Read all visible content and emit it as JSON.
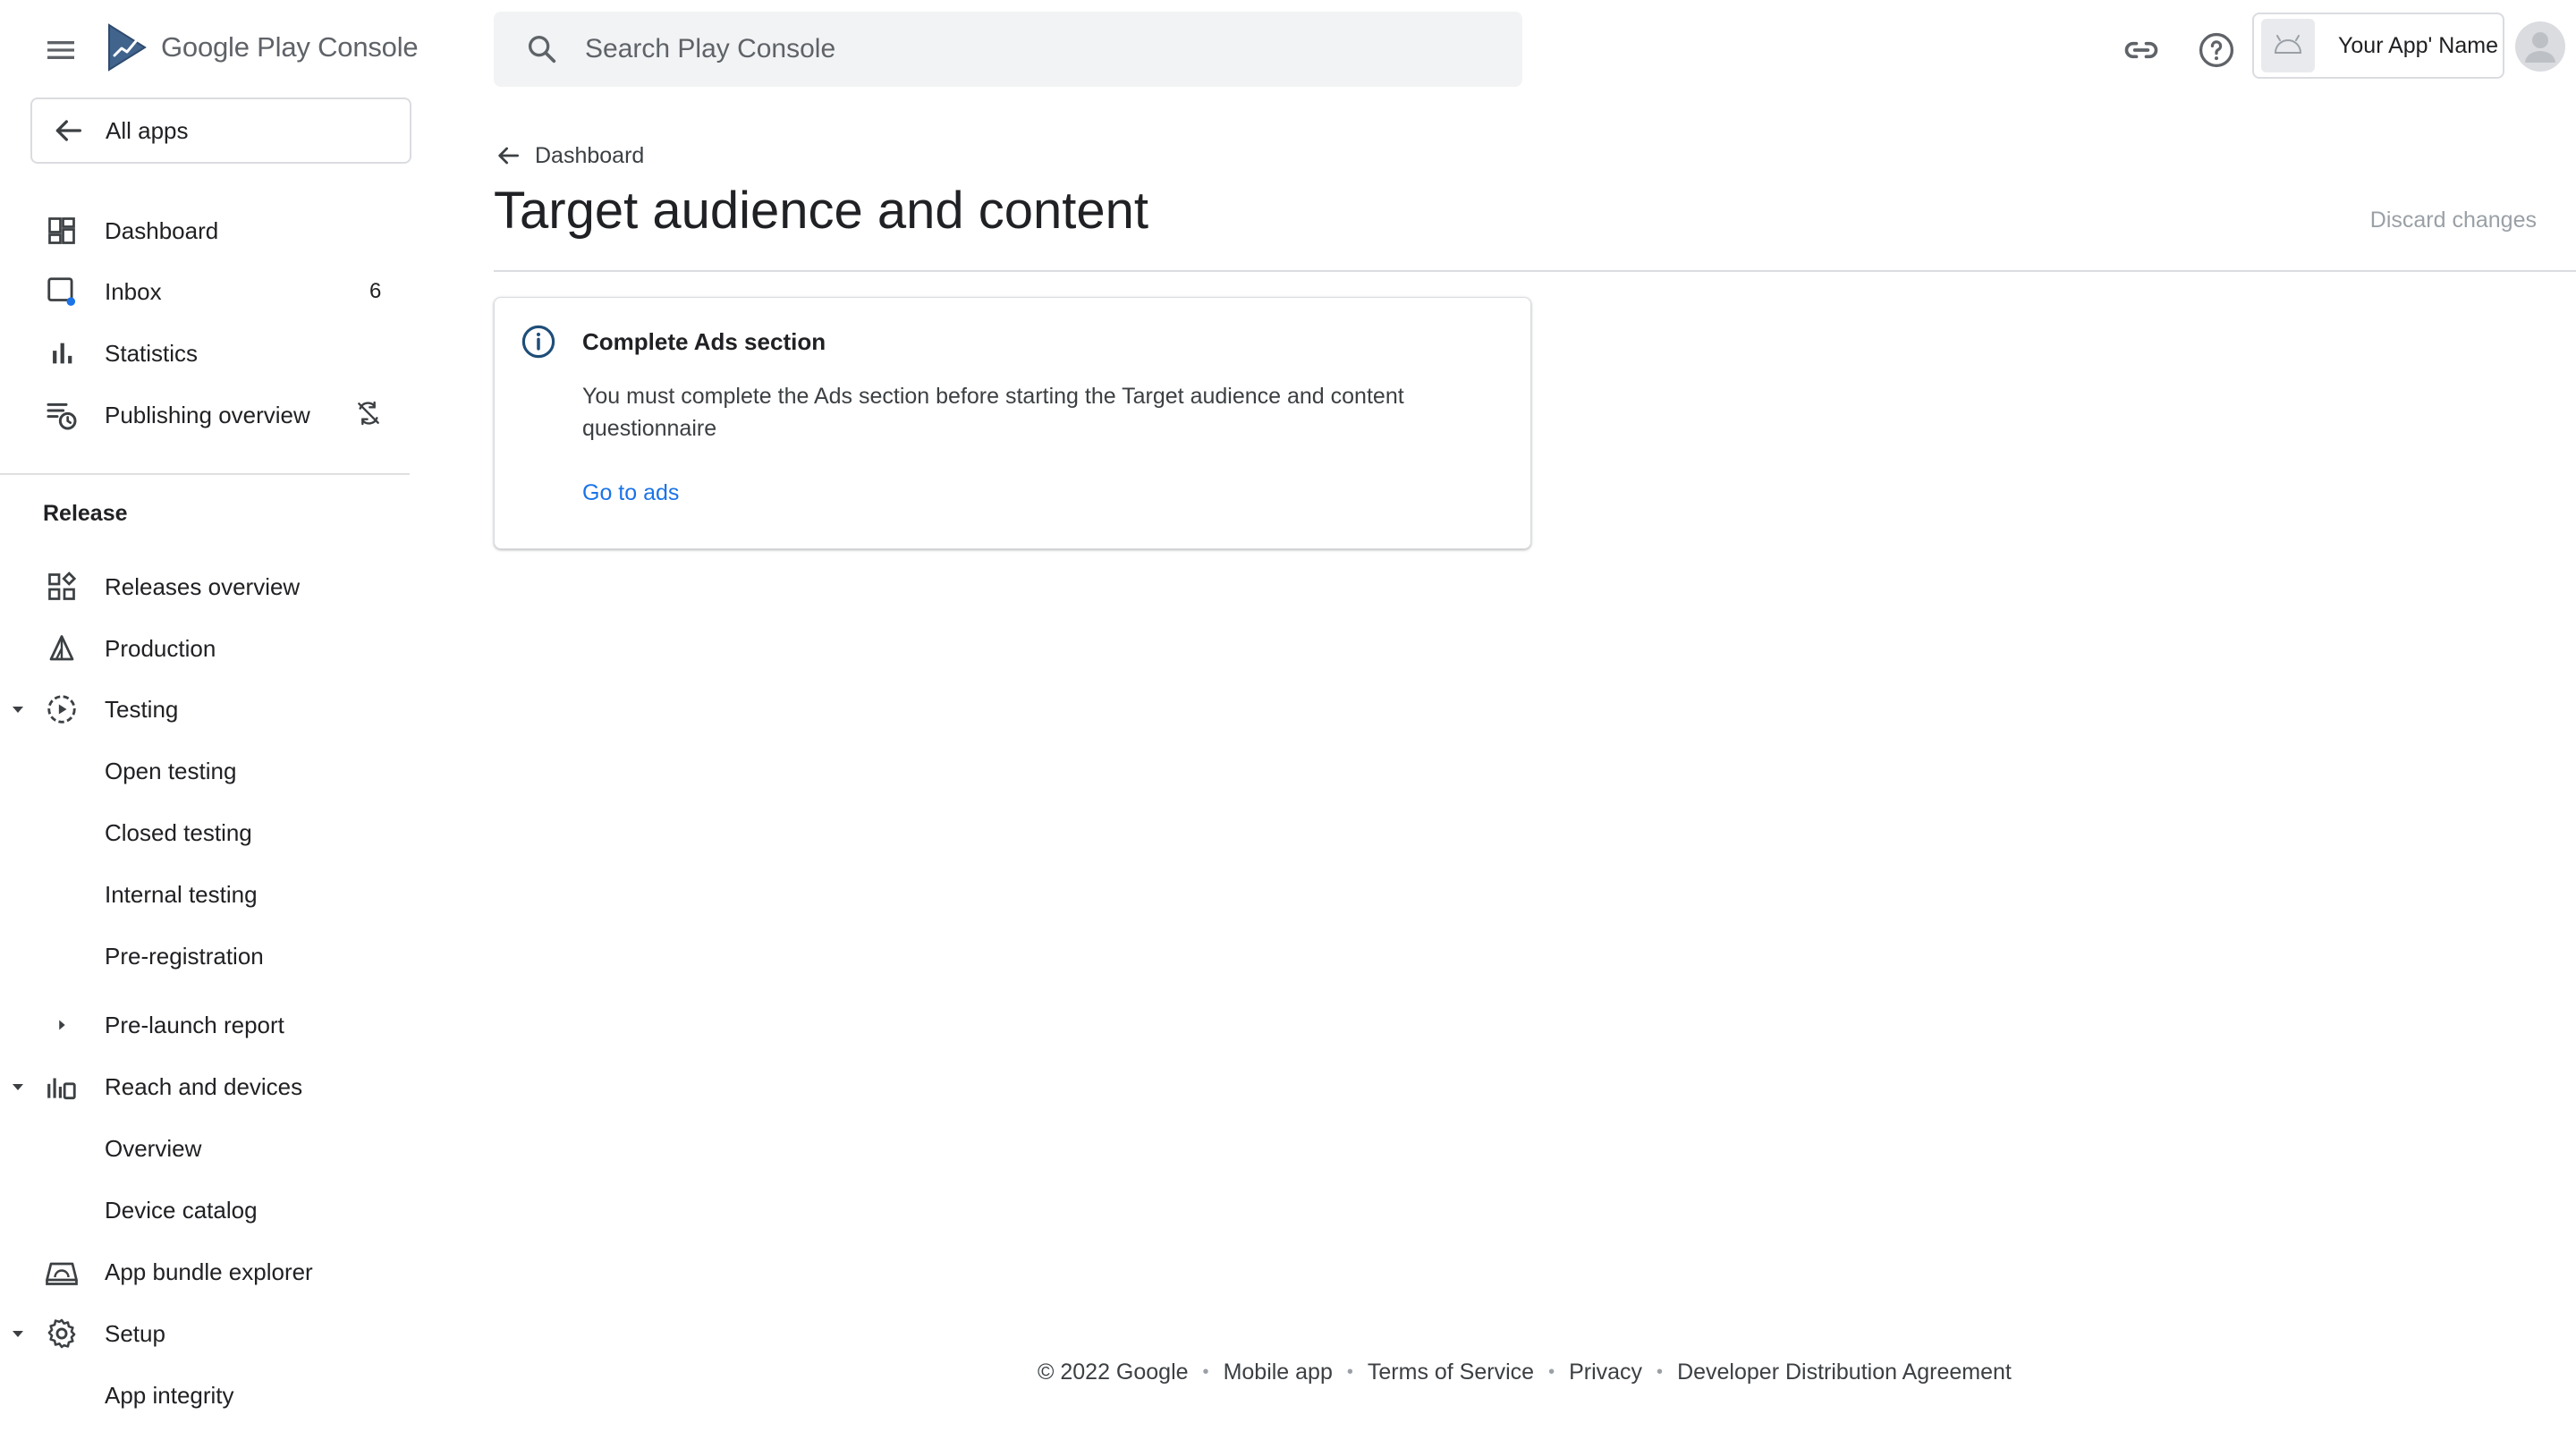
{
  "header": {
    "logo_google_play": "Google Play",
    "logo_console": "Console",
    "search_placeholder": "Search Play Console",
    "app_name": "Your App' Name"
  },
  "sidebar": {
    "all_apps_label": "All apps",
    "top_items": [
      {
        "label": "Dashboard"
      },
      {
        "label": "Inbox",
        "count": "6"
      },
      {
        "label": "Statistics"
      },
      {
        "label": "Publishing overview"
      }
    ],
    "release_section_title": "Release",
    "release_items": [
      {
        "label": "Releases overview"
      },
      {
        "label": "Production"
      },
      {
        "label": "Testing"
      },
      {
        "label": "Open testing"
      },
      {
        "label": "Closed testing"
      },
      {
        "label": "Internal testing"
      },
      {
        "label": "Pre-registration"
      },
      {
        "label": "Pre-launch report"
      },
      {
        "label": "Reach and devices"
      },
      {
        "label": "Overview"
      },
      {
        "label": "Device catalog"
      },
      {
        "label": "App bundle explorer"
      },
      {
        "label": "Setup"
      },
      {
        "label": "App integrity"
      }
    ]
  },
  "main": {
    "back_label": "Dashboard",
    "page_title": "Target audience and content",
    "discard_label": "Discard changes",
    "card": {
      "title": "Complete Ads section",
      "body": "You must complete the Ads section before starting the Target audience and content questionnaire",
      "link_label": "Go to ads"
    }
  },
  "footer": {
    "copyright": "© 2022 Google",
    "links": [
      "Mobile app",
      "Terms of Service",
      "Privacy",
      "Developer Distribution Agreement"
    ]
  },
  "colors": {
    "accent_link": "#1a73e8",
    "inbox_dot": "#1a73e8",
    "text_primary": "#202124",
    "text_muted": "#9aa0a6",
    "search_bg": "#f1f3f4"
  }
}
